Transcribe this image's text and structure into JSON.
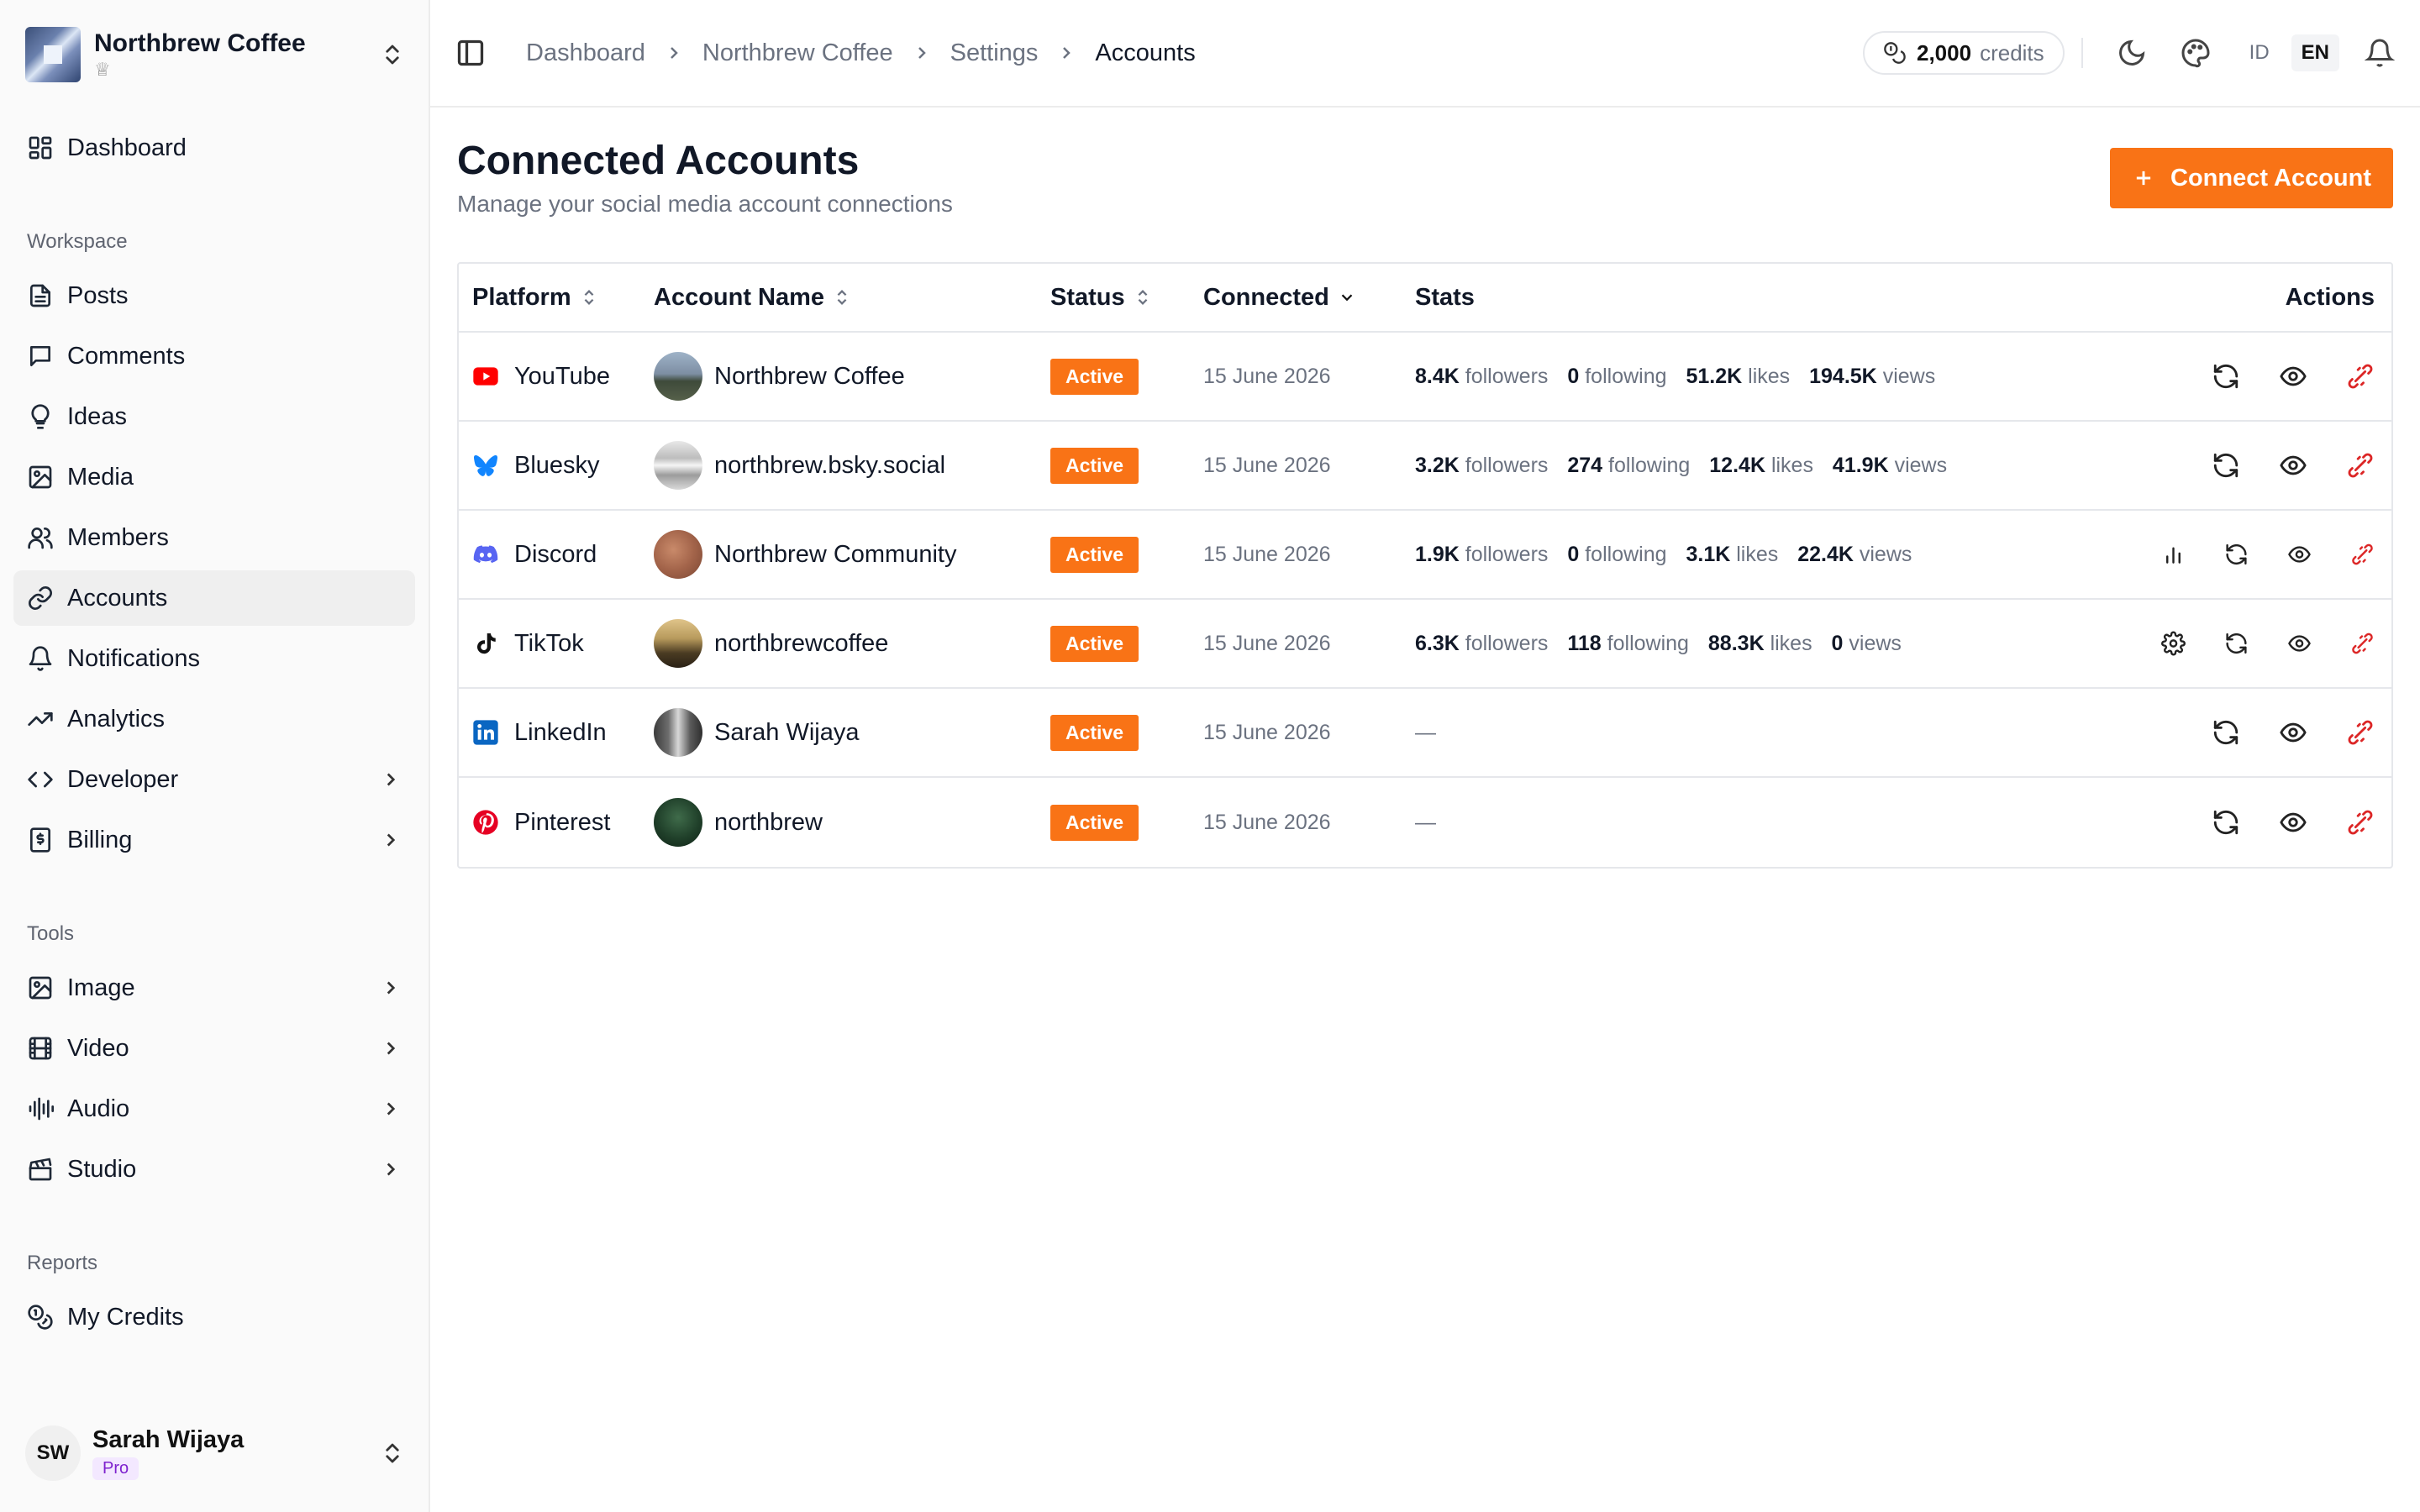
{
  "workspace": {
    "name": "Northbrew Coffee"
  },
  "sidebar": {
    "dashboard": "Dashboard",
    "section_workspace": "Workspace",
    "section_tools": "Tools",
    "section_reports": "Reports",
    "items": [
      {
        "label": "Posts"
      },
      {
        "label": "Comments"
      },
      {
        "label": "Ideas"
      },
      {
        "label": "Media"
      },
      {
        "label": "Members"
      },
      {
        "label": "Accounts"
      },
      {
        "label": "Notifications"
      },
      {
        "label": "Analytics"
      },
      {
        "label": "Developer"
      },
      {
        "label": "Billing"
      }
    ],
    "tools": [
      {
        "label": "Image"
      },
      {
        "label": "Video"
      },
      {
        "label": "Audio"
      },
      {
        "label": "Studio"
      }
    ],
    "reports": [
      {
        "label": "My Credits"
      }
    ]
  },
  "user": {
    "initials": "SW",
    "name": "Sarah Wijaya",
    "plan": "Pro"
  },
  "breadcrumb": [
    "Dashboard",
    "Northbrew Coffee",
    "Settings",
    "Accounts"
  ],
  "topbar": {
    "credits_value": "2,000",
    "credits_label": "credits",
    "lang_id": "ID",
    "lang_en": "EN"
  },
  "page": {
    "title": "Connected Accounts",
    "subtitle": "Manage your social media account connections",
    "connect_button": "Connect Account"
  },
  "table": {
    "headers": {
      "platform": "Platform",
      "account": "Account Name",
      "status": "Status",
      "connected": "Connected",
      "stats": "Stats",
      "actions": "Actions"
    },
    "stat_labels": {
      "followers": "followers",
      "following": "following",
      "likes": "likes",
      "views": "views"
    },
    "rows": [
      {
        "platform": "YouTube",
        "account": "Northbrew Coffee",
        "status": "Active",
        "connected": "15 June 2026",
        "stats": {
          "followers": "8.4K",
          "following": "0",
          "likes": "51.2K",
          "views": "194.5K"
        }
      },
      {
        "platform": "Bluesky",
        "account": "northbrew.bsky.social",
        "status": "Active",
        "connected": "15 June 2026",
        "stats": {
          "followers": "3.2K",
          "following": "274",
          "likes": "12.4K",
          "views": "41.9K"
        }
      },
      {
        "platform": "Discord",
        "account": "Northbrew Community",
        "status": "Active",
        "connected": "15 June 2026",
        "stats": {
          "followers": "1.9K",
          "following": "0",
          "likes": "3.1K",
          "views": "22.4K"
        }
      },
      {
        "platform": "TikTok",
        "account": "northbrewcoffee",
        "status": "Active",
        "connected": "15 June 2026",
        "stats": {
          "followers": "6.3K",
          "following": "118",
          "likes": "88.3K",
          "views": "0"
        }
      },
      {
        "platform": "LinkedIn",
        "account": "Sarah Wijaya",
        "status": "Active",
        "connected": "15 June 2026",
        "stats_empty": "—"
      },
      {
        "platform": "Pinterest",
        "account": "northbrew",
        "status": "Active",
        "connected": "15 June 2026",
        "stats_empty": "—"
      }
    ]
  },
  "colors": {
    "accent": "#f97316",
    "danger": "#dc2626",
    "youtube": "#ff0000",
    "bluesky": "#1185fe",
    "discord": "#5865f2",
    "linkedin": "#0a66c2",
    "pinterest": "#e60023"
  }
}
